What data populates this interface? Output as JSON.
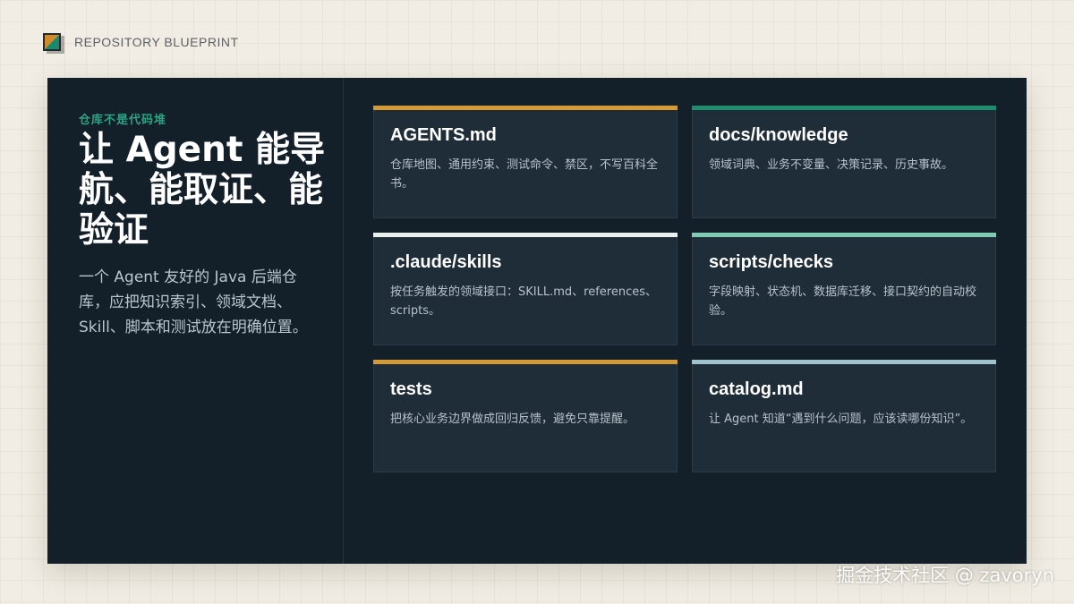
{
  "brand": {
    "label": "REPOSITORY BLUEPRINT",
    "logo_icon": "blueprint-logo-icon",
    "logo_colors": {
      "triangle_a": "#d08a2a",
      "triangle_b": "#1a8a6c",
      "border": "#1f2a33"
    }
  },
  "hero": {
    "kicker": "仓库不是代码堆",
    "title": "让 Agent 能导航、能取证、能验证",
    "description": "一个 Agent 友好的 Java 后端仓库，应把知识索引、领域文档、Skill、脚本和测试放在明确位置。"
  },
  "colors": {
    "panel": "#13202a",
    "card": "#1f2d38",
    "kicker": "#2ea283"
  },
  "cards": [
    {
      "title": "AGENTS.md",
      "description": "仓库地图、通用约束、测试命令、禁区，不写百科全书。",
      "accent": "#d49a35"
    },
    {
      "title": "docs/knowledge",
      "description": "领域词典、业务不变量、决策记录、历史事故。",
      "accent": "#1f8c6e"
    },
    {
      "title": ".claude/skills",
      "description": "按任务触发的领域接口：SKILL.md、references、scripts。",
      "accent": "#e8f1ee"
    },
    {
      "title": "scripts/checks",
      "description": "字段映射、状态机、数据库迁移、接口契约的自动校验。",
      "accent": "#7fcab3"
    },
    {
      "title": "tests",
      "description": "把核心业务边界做成回归反馈，避免只靠提醒。",
      "accent": "#d49a35"
    },
    {
      "title": "catalog.md",
      "description": "让 Agent 知道“遇到什么问题，应该读哪份知识”。",
      "accent": "#9ec3cc"
    }
  ],
  "watermark": "掘金技术社区 @ zavoryn"
}
